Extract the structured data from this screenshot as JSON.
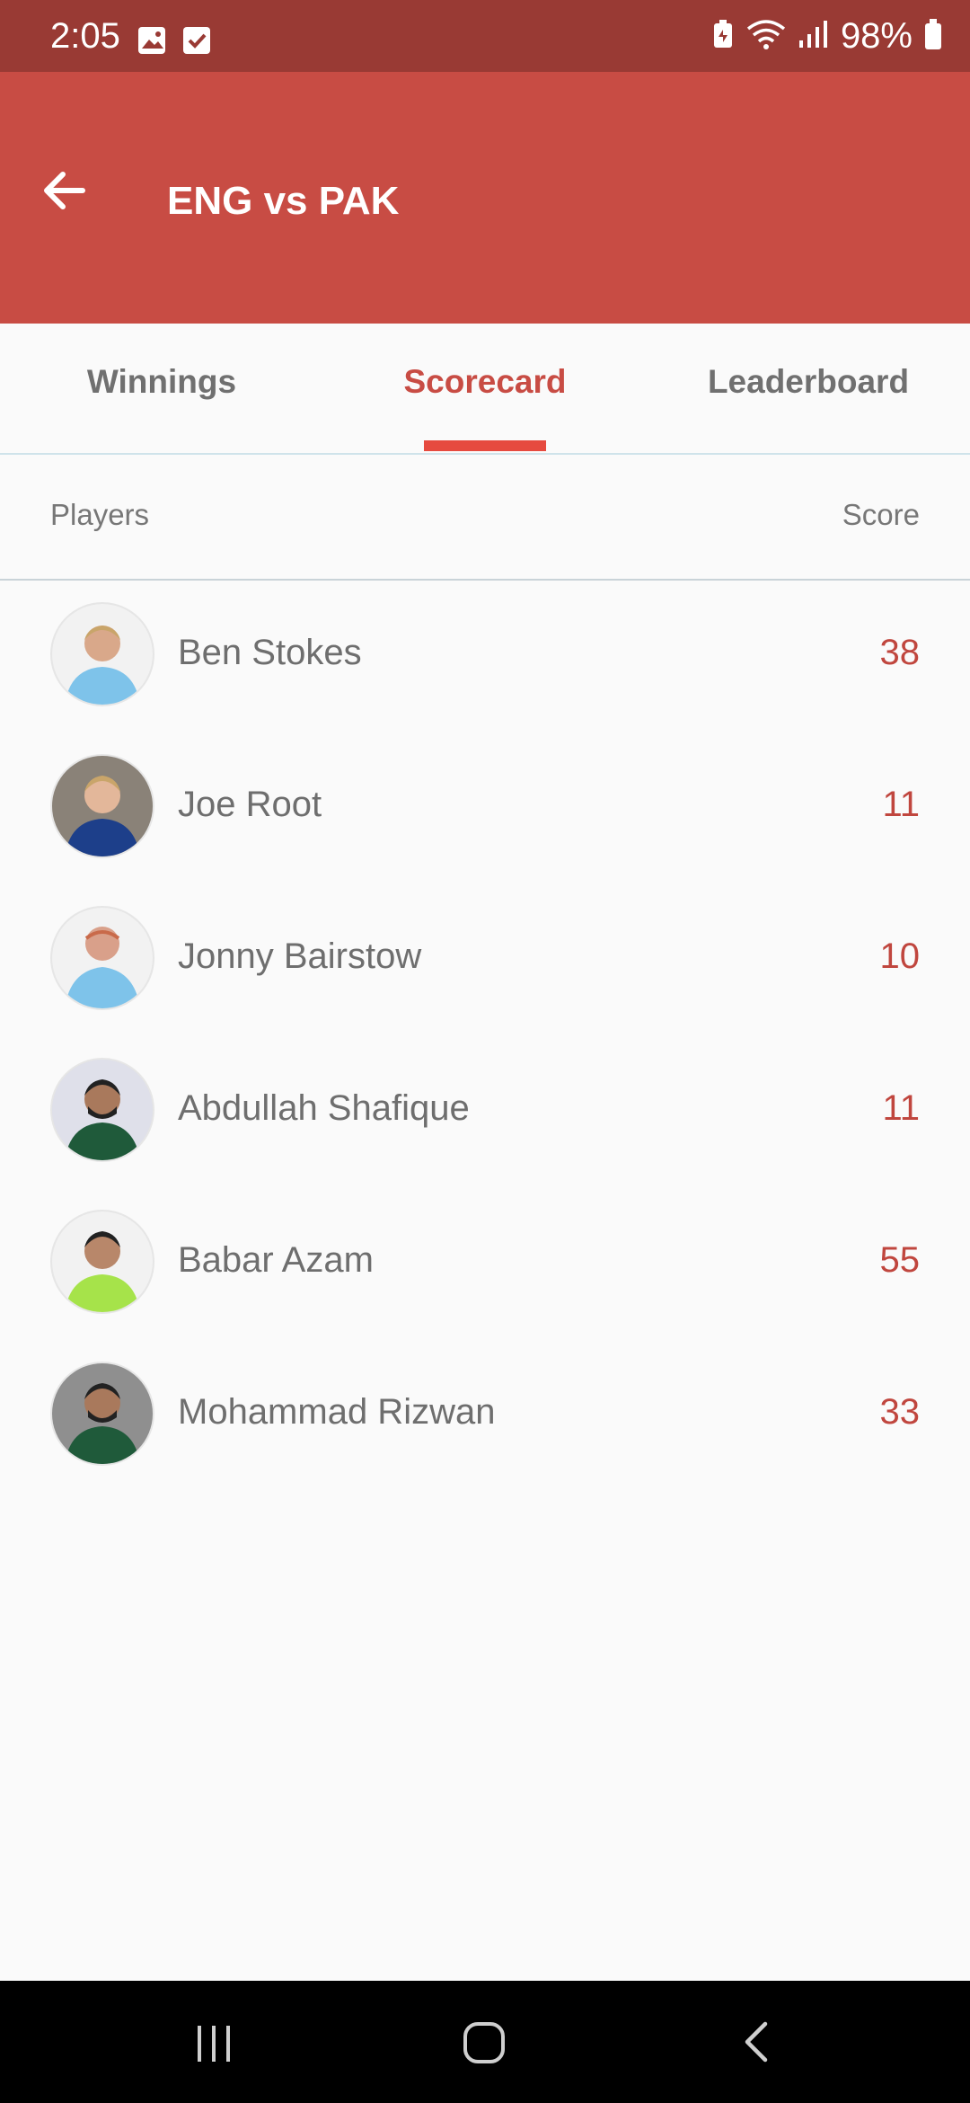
{
  "status_bar": {
    "time": "2:05",
    "battery": "98%",
    "icons": [
      "gallery-icon",
      "checkbox-icon",
      "battery-saver-icon",
      "wifi-icon",
      "signal-icon",
      "battery-icon"
    ]
  },
  "app_bar": {
    "title": "ENG vs PAK",
    "back_icon": "arrow-left-icon",
    "background": "#c84c44"
  },
  "tabs": [
    {
      "label": "Winnings",
      "active": false
    },
    {
      "label": "Scorecard",
      "active": true
    },
    {
      "label": "Leaderboard",
      "active": false
    }
  ],
  "list_header": {
    "players": "Players",
    "score": "Score"
  },
  "players": [
    {
      "name": "Ben Stokes",
      "score": "38",
      "shirt": "#7ec3ea"
    },
    {
      "name": "Joe Root",
      "score": "11",
      "shirt": "#1d3f8a"
    },
    {
      "name": "Jonny Bairstow",
      "score": "10",
      "shirt": "#7ec3ea"
    },
    {
      "name": "Abdullah Shafique",
      "score": "11",
      "shirt": "#1f5a3a"
    },
    {
      "name": "Babar Azam",
      "score": "55",
      "shirt": "#a6e34a"
    },
    {
      "name": "Mohammad Rizwan",
      "score": "33",
      "shirt": "#1f5a3a"
    }
  ],
  "colors": {
    "accent": "#c84c44",
    "score": "#c0463e",
    "tab_indicator": "#e64a3f"
  },
  "nav_bar": {
    "icons": [
      "recent-apps-icon",
      "home-icon",
      "back-icon"
    ]
  }
}
